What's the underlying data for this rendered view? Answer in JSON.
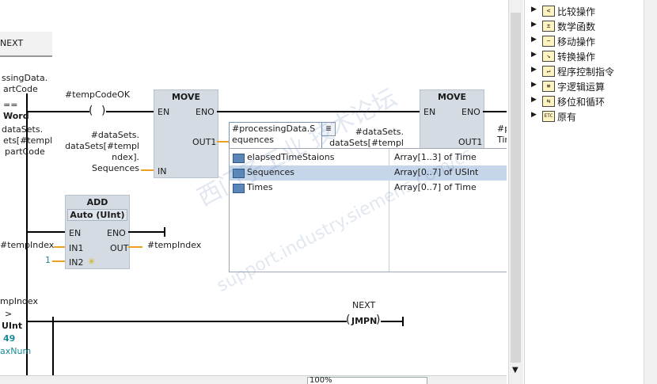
{
  "network_top": {
    "label": "NEXT",
    "cmp_lines": [
      "ssingData.",
      "artCode",
      "==",
      "Word",
      "dataSets.",
      "ets[#templ",
      "partCode"
    ]
  },
  "contact": {
    "label": "#tempCodeOK"
  },
  "move1": {
    "title": "MOVE",
    "en": "EN",
    "eno": "ENO",
    "out1": "OUT1",
    "in": "IN",
    "in_operand": [
      "#dataSets.",
      "dataSets[#templ",
      "ndex].",
      "Sequences"
    ],
    "out_operand": [
      "#processingData.S",
      "equences"
    ]
  },
  "move2": {
    "title": "MOVE",
    "en": "EN",
    "eno": "ENO",
    "out1": "OUT1",
    "in_operand": [
      "#dataSets.",
      "dataSets[#templ"
    ],
    "out_operand": [
      "#p",
      "Tin"
    ]
  },
  "add": {
    "title": "ADD",
    "subtitle": "Auto (UInt)",
    "en": "EN",
    "eno": "ENO",
    "in1": "IN1",
    "in2": "IN2",
    "out": "OUT",
    "in1_operand": "#tempIndex",
    "in2_operand": "1",
    "out_operand": "#tempIndex"
  },
  "network_bottom": {
    "cmp_lines": [
      "mpIndex",
      ">",
      "UInt",
      "49",
      "axNum"
    ],
    "coil_label": "NEXT",
    "coil": "JMPN"
  },
  "dropdown": {
    "rows": [
      {
        "name": "elapsedTimeStaions",
        "type": "Array[1..3] of Time",
        "selected": false
      },
      {
        "name": "Sequences",
        "type": "Array[0..7] of USInt",
        "selected": true
      },
      {
        "name": "Times",
        "type": "Array[0..7] of Time",
        "selected": false
      }
    ]
  },
  "zoom": {
    "value": "100%"
  },
  "instructions_tree": {
    "items": [
      {
        "icon": "compare-icon",
        "label": "比较操作"
      },
      {
        "icon": "math-icon",
        "label": "数学函数"
      },
      {
        "icon": "move-icon",
        "label": "移动操作"
      },
      {
        "icon": "convert-icon",
        "label": "转换操作"
      },
      {
        "icon": "program-control-icon",
        "label": "程序控制指令"
      },
      {
        "icon": "word-logic-icon",
        "label": "字逻辑运算"
      },
      {
        "icon": "shift-rotate-icon",
        "label": "移位和循环"
      },
      {
        "icon": "legacy-icon",
        "label": "原有"
      }
    ]
  },
  "watermark": {
    "text": "西门子工业  技术论坛",
    "url": "support.industry.siemens.com/cs"
  },
  "colors": {
    "accent_orange": "#f0a020",
    "block_grey": "#d4dbe3",
    "selection": "#c5d5ea",
    "teal_const": "#1a8a9a"
  }
}
